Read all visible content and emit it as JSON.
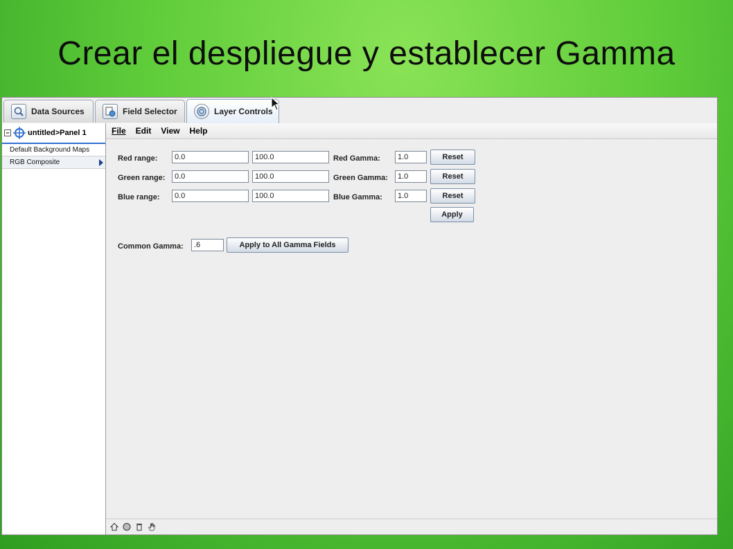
{
  "slide": {
    "title": "Crear el despliegue y establecer Gamma"
  },
  "tabs": [
    {
      "label": "Data Sources",
      "icon": "data-sources-icon"
    },
    {
      "label": "Field Selector",
      "icon": "field-selector-icon"
    },
    {
      "label": "Layer Controls",
      "icon": "layer-controls-icon",
      "active": true
    }
  ],
  "tree": {
    "root_label": "untitled>Panel 1",
    "items": [
      {
        "label": "Default Background Maps"
      },
      {
        "label": "RGB Composite",
        "selected": true
      }
    ]
  },
  "menu": {
    "file": "File",
    "edit": "Edit",
    "view": "View",
    "help": "Help"
  },
  "rgb": {
    "rows": [
      {
        "range_label": "Red range:",
        "min": "0.0",
        "max": "100.0",
        "gamma_label": "Red Gamma:",
        "gamma": "1.0",
        "reset": "Reset"
      },
      {
        "range_label": "Green range:",
        "min": "0.0",
        "max": "100.0",
        "gamma_label": "Green Gamma:",
        "gamma": "1.0",
        "reset": "Reset"
      },
      {
        "range_label": "Blue range:",
        "min": "0.0",
        "max": "100.0",
        "gamma_label": "Blue Gamma:",
        "gamma": "1.0",
        "reset": "Reset"
      }
    ],
    "apply": "Apply",
    "common_gamma_label": "Common Gamma:",
    "common_gamma_value": ".6",
    "apply_all": "Apply to All Gamma Fields"
  },
  "colors": {
    "tree_highlight": "#2f6fd0",
    "slide_bg": "#5fcc3a"
  }
}
